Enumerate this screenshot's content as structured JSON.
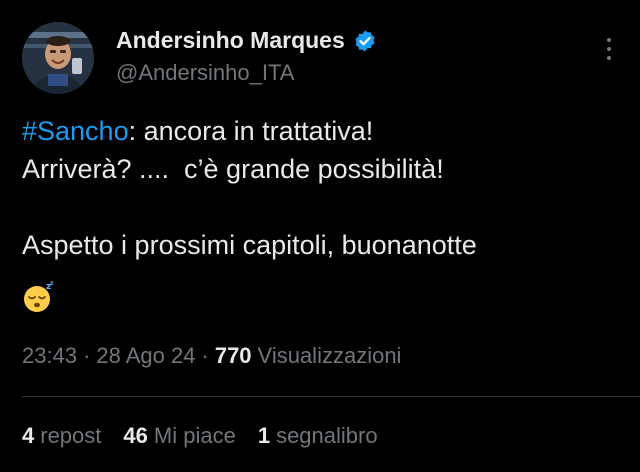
{
  "author": {
    "name": "Andersinho Marques",
    "handle": "@Andersinho_ITA",
    "verified": true,
    "verified_color": "#1d9bf0"
  },
  "tweet": {
    "hashtag": "#Sancho",
    "line1_rest": ": ancora in trattativa!",
    "line2": "Arriverà? ....  c’è grande possibilità!",
    "line3": "",
    "line4": "Aspetto i prossimi capitoli, buonanotte",
    "emoji": "sleeping-face"
  },
  "meta": {
    "time": "23:43",
    "sep1": "·",
    "date": "28 Ago 24",
    "sep2": "·",
    "views_count": "770",
    "views_label": "Visualizzazioni"
  },
  "stats": {
    "reposts_count": "4",
    "reposts_label": "repost",
    "likes_count": "46",
    "likes_label": "Mi piace",
    "bookmarks_count": "1",
    "bookmarks_label": "segnalibro"
  },
  "colors": {
    "background": "#000000",
    "text": "#e7e9ea",
    "muted": "#71767b",
    "link": "#1d9bf0"
  }
}
